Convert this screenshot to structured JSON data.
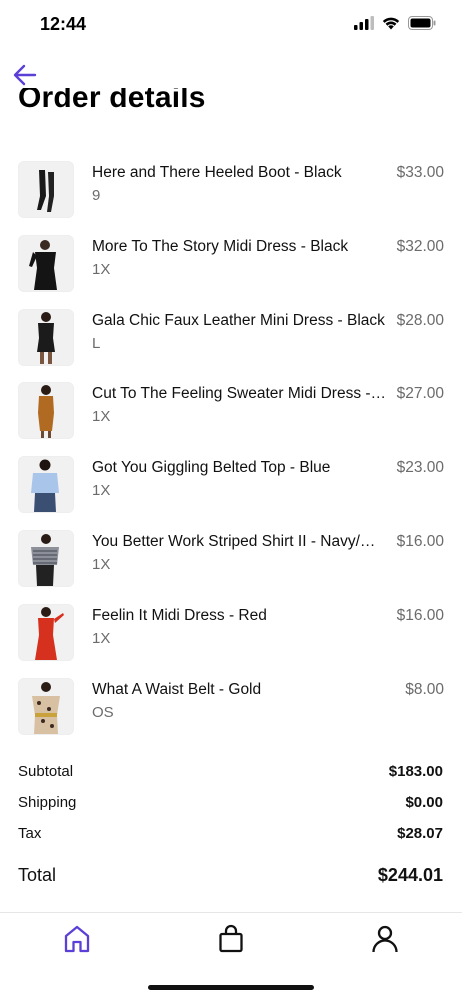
{
  "status_bar": {
    "time": "12:44"
  },
  "header": {
    "title": "Order details",
    "back_icon": "arrow-left-icon"
  },
  "theme": {
    "accent": "#5b3fd6"
  },
  "items": [
    {
      "name": "Here and There Heeled Boot - Black",
      "size": "9",
      "price": "$33.00"
    },
    {
      "name": "More To The Story Midi Dress - Black",
      "size": "1X",
      "price": "$32.00"
    },
    {
      "name": "Gala Chic Faux Leather Mini Dress - Black",
      "size": "L",
      "price": "$28.00"
    },
    {
      "name": "Cut To The Feeling Sweater Midi Dress - Camel",
      "size": "1X",
      "price": "$27.00"
    },
    {
      "name": "Got You Giggling Belted Top - Blue",
      "size": "1X",
      "price": "$23.00"
    },
    {
      "name": "You Better Work Striped Shirt II - Navy/White",
      "size": "1X",
      "price": "$16.00"
    },
    {
      "name": "Feelin It Midi Dress - Red",
      "size": "1X",
      "price": "$16.00"
    },
    {
      "name": "What A Waist Belt - Gold",
      "size": "OS",
      "price": "$8.00"
    }
  ],
  "summary": {
    "subtotal_label": "Subtotal",
    "subtotal": "$183.00",
    "shipping_label": "Shipping",
    "shipping": "$0.00",
    "tax_label": "Tax",
    "tax": "$28.07",
    "total_label": "Total",
    "total": "$244.01"
  },
  "tab_bar": {
    "tabs": [
      "home-icon",
      "shopping-bag-icon",
      "profile-icon"
    ],
    "active": "home-icon"
  }
}
